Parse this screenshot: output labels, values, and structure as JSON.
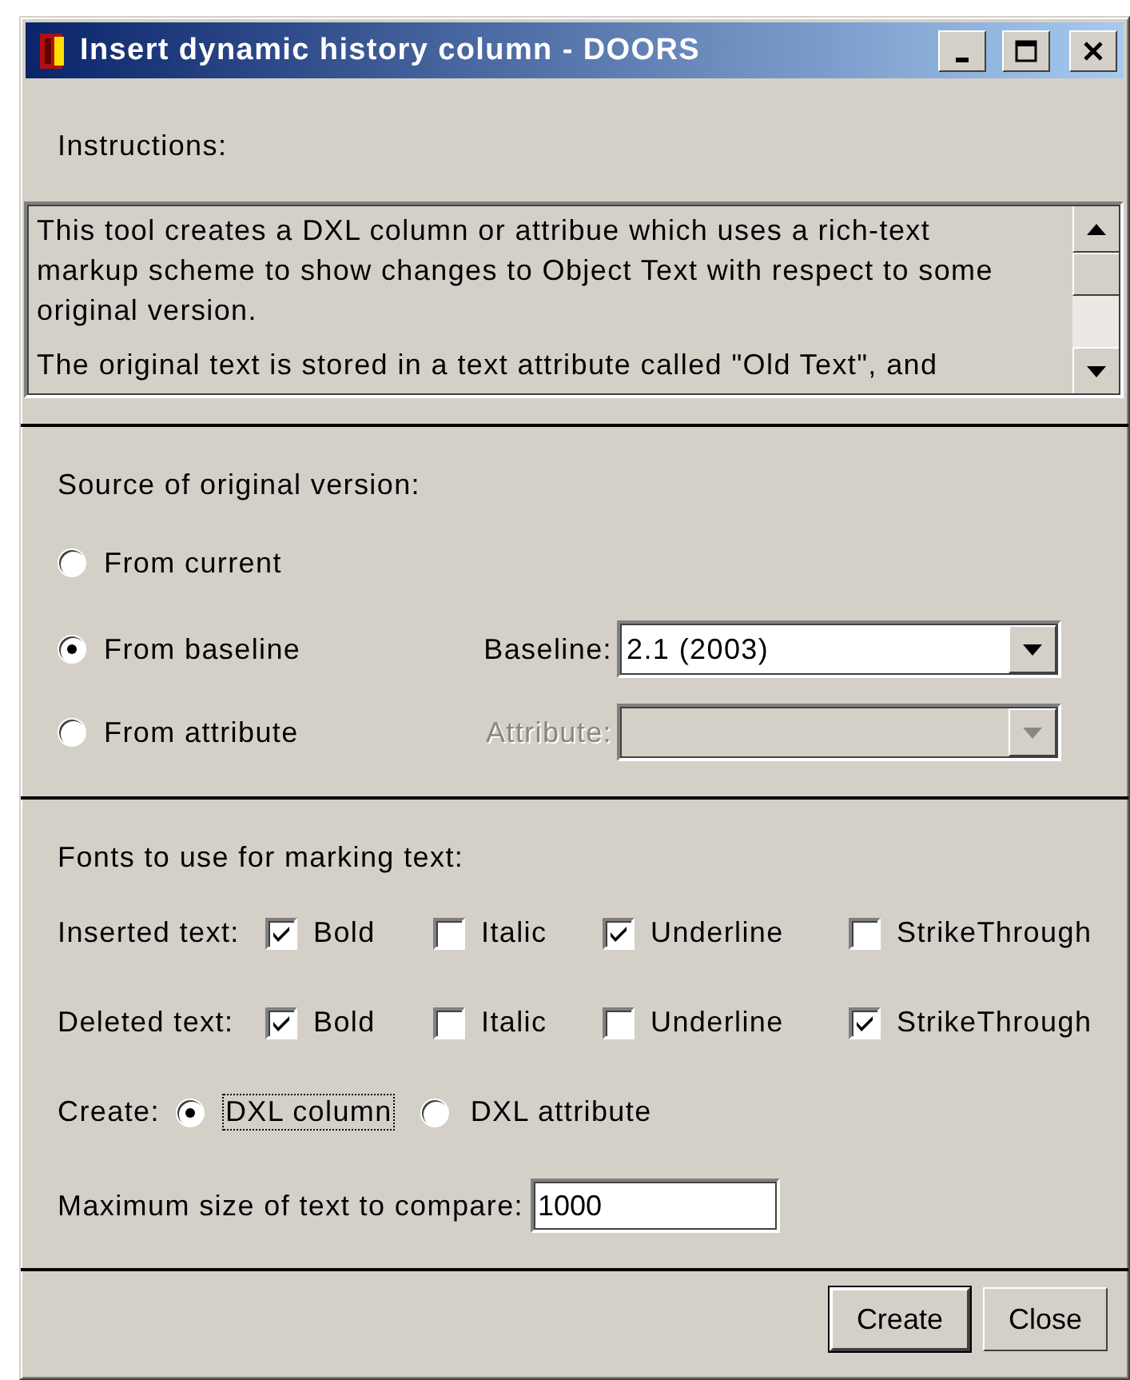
{
  "window": {
    "title": "Insert dynamic history column - DOORS"
  },
  "instructions": {
    "label": "Instructions:",
    "paragraphs": [
      "This tool creates a DXL column or attribue which uses a rich-text markup scheme to show changes to Object Text with respect to some original version.",
      "The original text is stored in a text attribute called \"Old Text\", and"
    ]
  },
  "source": {
    "label": "Source of original version:",
    "options": [
      {
        "label": "From current",
        "selected": false
      },
      {
        "label": "From baseline",
        "selected": true
      },
      {
        "label": "From attribute",
        "selected": false
      }
    ],
    "baseline": {
      "label": "Baseline:",
      "value": "2.1 (2003)",
      "disabled": false
    },
    "attribute": {
      "label": "Attribute:",
      "disabled": true
    }
  },
  "fonts": {
    "label": "Fonts to use for marking text:",
    "rows": [
      {
        "label": "Inserted text:",
        "options": [
          {
            "label": "Bold",
            "checked": true
          },
          {
            "label": "Italic",
            "checked": false
          },
          {
            "label": "Underline",
            "checked": true
          },
          {
            "label": "StrikeThrough",
            "checked": false
          }
        ]
      },
      {
        "label": "Deleted text:",
        "options": [
          {
            "label": "Bold",
            "checked": true
          },
          {
            "label": "Italic",
            "checked": false
          },
          {
            "label": "Underline",
            "checked": false
          },
          {
            "label": "StrikeThrough",
            "checked": true
          }
        ]
      }
    ]
  },
  "create": {
    "label": "Create:",
    "options": [
      {
        "label": "DXL column",
        "selected": true,
        "focused": true
      },
      {
        "label": "DXL attribute",
        "selected": false,
        "focused": false
      }
    ]
  },
  "max_size": {
    "label": "Maximum size of text to compare:",
    "value": "1000"
  },
  "buttons": [
    {
      "label": "Create",
      "default": true
    },
    {
      "label": "Close",
      "default": false
    }
  ]
}
